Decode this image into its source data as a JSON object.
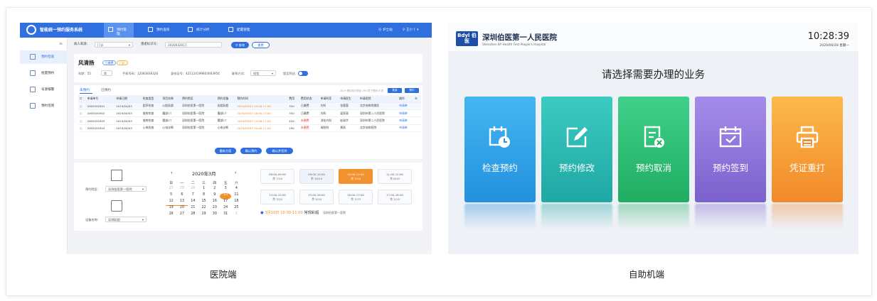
{
  "hospital": {
    "brand": "智能统一预约服务系统",
    "nav": [
      {
        "label": "预约管理",
        "active": true
      },
      {
        "label": "预约查询",
        "active": false
      },
      {
        "label": "统计分析",
        "active": false
      },
      {
        "label": "配置管理",
        "active": false
      }
    ],
    "hospital_tag": "护士站",
    "user": "王小丫",
    "sidebar": [
      {
        "label": "预约检查",
        "active": true,
        "icon": "list-icon"
      },
      {
        "label": "批量预约",
        "active": false,
        "icon": "batch-icon"
      },
      {
        "label": "号源报警",
        "active": false,
        "icon": "alarm-icon"
      },
      {
        "label": "预约签到",
        "active": false,
        "icon": "checkin-icon"
      }
    ],
    "filter": {
      "source_label": "病人来源：",
      "source_value": "门诊",
      "patient_id_label": "患者标识号：",
      "patient_id_value": "2020032017",
      "search_button": "查询",
      "reset_button": "重置"
    },
    "patient": {
      "name": "风清扬",
      "tags": [
        "已缴费",
        "门诊"
      ],
      "age": "年龄：55",
      "gender": "男",
      "phone": "手机号码：12083836326",
      "id_card": "身份证号：421124199603063956",
      "contact_label": "联系方式：",
      "contact_value": "短信",
      "signed_label": "是否到达："
    },
    "table_tabs": [
      "未预约",
      "已预约"
    ],
    "table_note": "2019 预约总计项目 190 项 已预约 8 项",
    "table_buttons": [
      "批量",
      "预约"
    ],
    "table_headers": [
      "申请单号",
      "申请日期",
      "检查类型",
      "项目名称",
      "预约院区",
      "预约设备",
      "预约时间",
      "费用",
      "费用状态",
      "申请科室",
      "申请医生",
      "申请医院",
      "操作"
    ],
    "table_rows": [
      [
        "2002020301",
        "2019/04/03",
        "超声检查",
        "心脏彩超",
        "深圳伯医第一医院",
        "彩超彩超",
        "2019/03/03 10:00-11:00",
        "350",
        "已缴费",
        "内科",
        "张蓉蓉",
        "北京协和附属医",
        "申请单"
      ],
      [
        "2002020302",
        "2019/04/03",
        "放射检查",
        "腹部CT",
        "深圳伯医第一医院",
        "腹部CT",
        "2019/03/03 16:00-17:00",
        "350",
        "已缴费",
        "内科",
        "梁家丽",
        "深圳市第二人民医院",
        "申请单"
      ],
      [
        "2002020303",
        "2019/04/03",
        "放射检查",
        "腰部CT",
        "深圳伯医第一医院",
        "腰部CT",
        "2019/03/03 14:00-17:00",
        "420",
        "未缴费",
        "消化内科",
        "赵淑华",
        "深圳市第二人民医院",
        "申请单"
      ],
      [
        "2002020304",
        "2019/04/03",
        "心电检查",
        "心电诊断",
        "深圳伯医第一医院",
        "心电诊断",
        "2019/03/03 10:00-11:00",
        "290",
        "未缴费",
        "肾脏科",
        "黄丽",
        "北京协和医院",
        "申请单"
      ]
    ],
    "action_buttons": [
      "重新方案",
      "确认预约",
      "确认并签到"
    ],
    "campus_label": "预约院区：",
    "campus_value": "深圳伯医第一医院",
    "device_label": "设备名称：",
    "device_value": "深圳彩超",
    "calendar": {
      "title": "2020年3月",
      "prev": "‹",
      "next": "›",
      "weekdays": [
        "日",
        "一",
        "二",
        "三",
        "四",
        "五",
        "六"
      ],
      "days": [
        "27",
        "28",
        "29",
        "1",
        "2",
        "3",
        "4",
        "5",
        "6",
        "7",
        "8",
        "9",
        "10",
        "11",
        "12",
        "13",
        "14",
        "15",
        "16",
        "17",
        "18",
        "19",
        "20",
        "21",
        "22",
        "23",
        "24",
        "25",
        "26",
        "27",
        "28",
        "29",
        "30",
        "31",
        "1"
      ]
    },
    "slots": [
      {
        "time": "08:00-09:00",
        "count": "余 7/10"
      },
      {
        "time": "09:00-10:00",
        "count": "余 10/14"
      },
      {
        "time": "10:00-11:00",
        "count": "余 3/10"
      },
      {
        "time": "11:00-12:00",
        "count": "余 6/10"
      },
      {
        "time": "14:00-15:00",
        "count": "余 3/10"
      },
      {
        "time": "15:00-16:00",
        "count": "余 9/10"
      },
      {
        "time": "16:00-17:00",
        "count": "余 7/13"
      },
      {
        "time": "17:00-18:00",
        "count": "余 2/10"
      }
    ],
    "selected_summary": "3月10日 10:00-11:00",
    "selected_item": "常规彩超",
    "selected_hospital": "深圳伯医第一医院",
    "caption": "医院端"
  },
  "kiosk": {
    "logo_text": "Bdyl 伯医",
    "hospital_name": "深圳伯医第一人民医院",
    "hospital_en": "Shenzhen BY Health First People's Hospital",
    "time": "10:28:39",
    "date": "2020/06/28 星期一",
    "prompt": "请选择需要办理的业务",
    "tiles": [
      {
        "label": "检查预约",
        "icon": "calendar-clock-icon",
        "color": "#2ea3ea"
      },
      {
        "label": "预约修改",
        "icon": "edit-icon",
        "color": "#27b8b1"
      },
      {
        "label": "预约取消",
        "icon": "cancel-document-icon",
        "color": "#2bbe74"
      },
      {
        "label": "预约签到",
        "icon": "calendar-check-icon",
        "color": "#8b73d8"
      },
      {
        "label": "凭证重打",
        "icon": "printer-icon",
        "color": "#f5a13a"
      }
    ],
    "caption": "自助机端"
  }
}
